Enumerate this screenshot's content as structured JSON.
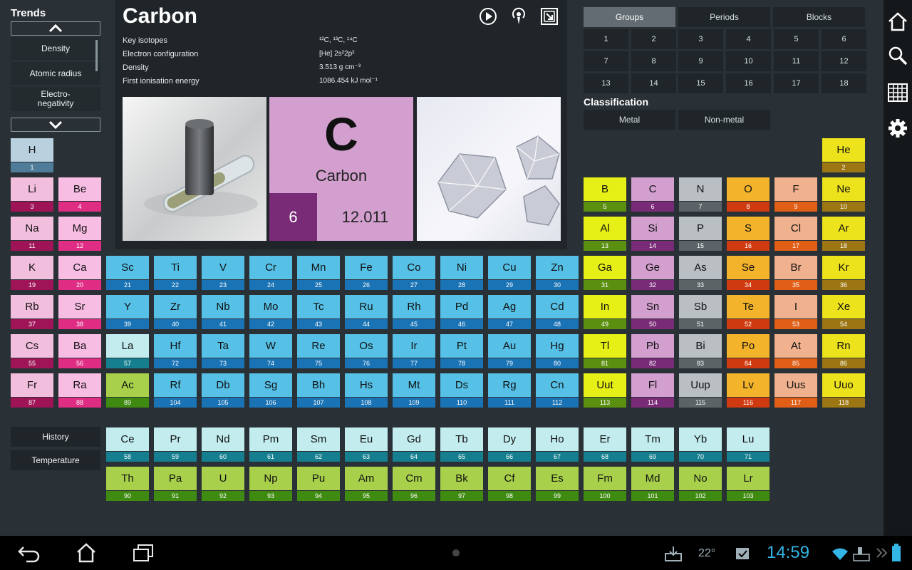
{
  "trends": {
    "title": "Trends",
    "items": [
      "Density",
      "Atomic radius",
      "Electro-\nnegativity"
    ],
    "bottom": [
      "History",
      "Temperature"
    ]
  },
  "element": {
    "name": "Carbon",
    "symbol": "C",
    "number": "6",
    "mass": "12.011",
    "props": [
      {
        "label": "Key isotopes",
        "value": "¹²C, ¹³C, ¹⁴C"
      },
      {
        "label": "Electron configuration",
        "value": "[He] 2s²2p²"
      },
      {
        "label": "Density",
        "value": "3.513 g cm⁻³"
      },
      {
        "label": "First ionisation energy",
        "value": "1086.454 kJ mol⁻¹"
      }
    ]
  },
  "tabs": [
    "Groups",
    "Periods",
    "Blocks"
  ],
  "active_tab": "Groups",
  "groups": [
    "1",
    "2",
    "3",
    "4",
    "5",
    "6",
    "7",
    "8",
    "9",
    "10",
    "11",
    "12",
    "13",
    "14",
    "15",
    "16",
    "17",
    "18"
  ],
  "classification": {
    "title": "Classification",
    "buttons": [
      "Metal",
      "Non-metal"
    ]
  },
  "status": {
    "temperature": "22°",
    "time": "14:59"
  },
  "categories": {
    "nonmetal": [
      "#b9d1de",
      "#4f7d99"
    ],
    "alkali": [
      "#f2bedd",
      "#9e1457"
    ],
    "alkaline": [
      "#f8bde3",
      "#e02d84"
    ],
    "transition": [
      "#56c0e6",
      "#1a73b5"
    ],
    "post_transition": [
      "#e6f016",
      "#5b8f10"
    ],
    "metalloid": [
      "#d39fcf",
      "#7a2b77"
    ],
    "carbon_group": [
      "#d39fcf",
      "#7a2b77"
    ],
    "pnictogen": [
      "#b9bfc2",
      "#5b6367"
    ],
    "chalcogen": [
      "#f3b32b",
      "#d03a10"
    ],
    "halogen": [
      "#f0b18e",
      "#e05e16"
    ],
    "noble": [
      "#ede31c",
      "#9c7612"
    ],
    "lanthanide": [
      "#c2ecee",
      "#157f8f"
    ],
    "actinide": [
      "#a8d04a",
      "#3f8a10"
    ]
  },
  "table_elements": [
    {
      "sym": "H",
      "num": "1",
      "cat": "nonmetal"
    },
    {
      "sym": "He",
      "num": "2",
      "cat": "noble"
    },
    {
      "sym": "Li",
      "num": "3",
      "cat": "alkali"
    },
    {
      "sym": "Be",
      "num": "4",
      "cat": "alkaline"
    },
    {
      "sym": "B",
      "num": "5",
      "cat": "post_transition"
    },
    {
      "sym": "C",
      "num": "6",
      "cat": "carbon_group"
    },
    {
      "sym": "N",
      "num": "7",
      "cat": "pnictogen"
    },
    {
      "sym": "O",
      "num": "8",
      "cat": "chalcogen"
    },
    {
      "sym": "F",
      "num": "9",
      "cat": "halogen"
    },
    {
      "sym": "Ne",
      "num": "10",
      "cat": "noble"
    },
    {
      "sym": "Na",
      "num": "11",
      "cat": "alkali"
    },
    {
      "sym": "Mg",
      "num": "12",
      "cat": "alkaline"
    },
    {
      "sym": "Al",
      "num": "13",
      "cat": "post_transition"
    },
    {
      "sym": "Si",
      "num": "14",
      "cat": "carbon_group"
    },
    {
      "sym": "P",
      "num": "15",
      "cat": "pnictogen"
    },
    {
      "sym": "S",
      "num": "16",
      "cat": "chalcogen"
    },
    {
      "sym": "Cl",
      "num": "17",
      "cat": "halogen"
    },
    {
      "sym": "Ar",
      "num": "18",
      "cat": "noble"
    },
    {
      "sym": "K",
      "num": "19",
      "cat": "alkali"
    },
    {
      "sym": "Ca",
      "num": "20",
      "cat": "alkaline"
    },
    {
      "sym": "Sc",
      "num": "21",
      "cat": "transition"
    },
    {
      "sym": "Ti",
      "num": "22",
      "cat": "transition"
    },
    {
      "sym": "V",
      "num": "23",
      "cat": "transition"
    },
    {
      "sym": "Cr",
      "num": "24",
      "cat": "transition"
    },
    {
      "sym": "Mn",
      "num": "25",
      "cat": "transition"
    },
    {
      "sym": "Fe",
      "num": "26",
      "cat": "transition"
    },
    {
      "sym": "Co",
      "num": "27",
      "cat": "transition"
    },
    {
      "sym": "Ni",
      "num": "28",
      "cat": "transition"
    },
    {
      "sym": "Cu",
      "num": "29",
      "cat": "transition"
    },
    {
      "sym": "Zn",
      "num": "30",
      "cat": "transition"
    },
    {
      "sym": "Ga",
      "num": "31",
      "cat": "post_transition"
    },
    {
      "sym": "Ge",
      "num": "32",
      "cat": "carbon_group"
    },
    {
      "sym": "As",
      "num": "33",
      "cat": "pnictogen"
    },
    {
      "sym": "Se",
      "num": "34",
      "cat": "chalcogen"
    },
    {
      "sym": "Br",
      "num": "35",
      "cat": "halogen"
    },
    {
      "sym": "Kr",
      "num": "36",
      "cat": "noble"
    },
    {
      "sym": "Rb",
      "num": "37",
      "cat": "alkali"
    },
    {
      "sym": "Sr",
      "num": "38",
      "cat": "alkaline"
    },
    {
      "sym": "Y",
      "num": "39",
      "cat": "transition"
    },
    {
      "sym": "Zr",
      "num": "40",
      "cat": "transition"
    },
    {
      "sym": "Nb",
      "num": "41",
      "cat": "transition"
    },
    {
      "sym": "Mo",
      "num": "42",
      "cat": "transition"
    },
    {
      "sym": "Tc",
      "num": "43",
      "cat": "transition"
    },
    {
      "sym": "Ru",
      "num": "44",
      "cat": "transition"
    },
    {
      "sym": "Rh",
      "num": "45",
      "cat": "transition"
    },
    {
      "sym": "Pd",
      "num": "46",
      "cat": "transition"
    },
    {
      "sym": "Ag",
      "num": "47",
      "cat": "transition"
    },
    {
      "sym": "Cd",
      "num": "48",
      "cat": "transition"
    },
    {
      "sym": "In",
      "num": "49",
      "cat": "post_transition"
    },
    {
      "sym": "Sn",
      "num": "50",
      "cat": "carbon_group"
    },
    {
      "sym": "Sb",
      "num": "51",
      "cat": "pnictogen"
    },
    {
      "sym": "Te",
      "num": "52",
      "cat": "chalcogen"
    },
    {
      "sym": "I",
      "num": "53",
      "cat": "halogen"
    },
    {
      "sym": "Xe",
      "num": "54",
      "cat": "noble"
    },
    {
      "sym": "Cs",
      "num": "55",
      "cat": "alkali"
    },
    {
      "sym": "Ba",
      "num": "56",
      "cat": "alkaline"
    },
    {
      "sym": "La",
      "num": "57",
      "cat": "lanthanide"
    },
    {
      "sym": "Hf",
      "num": "72",
      "cat": "transition"
    },
    {
      "sym": "Ta",
      "num": "73",
      "cat": "transition"
    },
    {
      "sym": "W",
      "num": "74",
      "cat": "transition"
    },
    {
      "sym": "Re",
      "num": "75",
      "cat": "transition"
    },
    {
      "sym": "Os",
      "num": "76",
      "cat": "transition"
    },
    {
      "sym": "Ir",
      "num": "77",
      "cat": "transition"
    },
    {
      "sym": "Pt",
      "num": "78",
      "cat": "transition"
    },
    {
      "sym": "Au",
      "num": "79",
      "cat": "transition"
    },
    {
      "sym": "Hg",
      "num": "80",
      "cat": "transition"
    },
    {
      "sym": "Tl",
      "num": "81",
      "cat": "post_transition"
    },
    {
      "sym": "Pb",
      "num": "82",
      "cat": "carbon_group"
    },
    {
      "sym": "Bi",
      "num": "83",
      "cat": "pnictogen"
    },
    {
      "sym": "Po",
      "num": "84",
      "cat": "chalcogen"
    },
    {
      "sym": "At",
      "num": "85",
      "cat": "halogen"
    },
    {
      "sym": "Rn",
      "num": "86",
      "cat": "noble"
    },
    {
      "sym": "Fr",
      "num": "87",
      "cat": "alkali"
    },
    {
      "sym": "Ra",
      "num": "88",
      "cat": "alkaline"
    },
    {
      "sym": "Ac",
      "num": "89",
      "cat": "actinide"
    },
    {
      "sym": "Rf",
      "num": "104",
      "cat": "transition"
    },
    {
      "sym": "Db",
      "num": "105",
      "cat": "transition"
    },
    {
      "sym": "Sg",
      "num": "106",
      "cat": "transition"
    },
    {
      "sym": "Bh",
      "num": "107",
      "cat": "transition"
    },
    {
      "sym": "Hs",
      "num": "108",
      "cat": "transition"
    },
    {
      "sym": "Mt",
      "num": "109",
      "cat": "transition"
    },
    {
      "sym": "Ds",
      "num": "110",
      "cat": "transition"
    },
    {
      "sym": "Rg",
      "num": "111",
      "cat": "transition"
    },
    {
      "sym": "Cn",
      "num": "112",
      "cat": "transition"
    },
    {
      "sym": "Uut",
      "num": "113",
      "cat": "post_transition"
    },
    {
      "sym": "Fl",
      "num": "114",
      "cat": "carbon_group"
    },
    {
      "sym": "Uup",
      "num": "115",
      "cat": "pnictogen"
    },
    {
      "sym": "Lv",
      "num": "116",
      "cat": "chalcogen"
    },
    {
      "sym": "Uus",
      "num": "117",
      "cat": "halogen"
    },
    {
      "sym": "Uuo",
      "num": "118",
      "cat": "noble"
    },
    {
      "sym": "Ce",
      "num": "58",
      "cat": "lanthanide"
    },
    {
      "sym": "Pr",
      "num": "59",
      "cat": "lanthanide"
    },
    {
      "sym": "Nd",
      "num": "60",
      "cat": "lanthanide"
    },
    {
      "sym": "Pm",
      "num": "61",
      "cat": "lanthanide"
    },
    {
      "sym": "Sm",
      "num": "62",
      "cat": "lanthanide"
    },
    {
      "sym": "Eu",
      "num": "63",
      "cat": "lanthanide"
    },
    {
      "sym": "Gd",
      "num": "64",
      "cat": "lanthanide"
    },
    {
      "sym": "Tb",
      "num": "65",
      "cat": "lanthanide"
    },
    {
      "sym": "Dy",
      "num": "66",
      "cat": "lanthanide"
    },
    {
      "sym": "Ho",
      "num": "67",
      "cat": "lanthanide"
    },
    {
      "sym": "Er",
      "num": "68",
      "cat": "lanthanide"
    },
    {
      "sym": "Tm",
      "num": "69",
      "cat": "lanthanide"
    },
    {
      "sym": "Yb",
      "num": "70",
      "cat": "lanthanide"
    },
    {
      "sym": "Lu",
      "num": "71",
      "cat": "lanthanide"
    },
    {
      "sym": "Th",
      "num": "90",
      "cat": "actinide"
    },
    {
      "sym": "Pa",
      "num": "91",
      "cat": "actinide"
    },
    {
      "sym": "U",
      "num": "92",
      "cat": "actinide"
    },
    {
      "sym": "Np",
      "num": "93",
      "cat": "actinide"
    },
    {
      "sym": "Pu",
      "num": "94",
      "cat": "actinide"
    },
    {
      "sym": "Am",
      "num": "95",
      "cat": "actinide"
    },
    {
      "sym": "Cm",
      "num": "96",
      "cat": "actinide"
    },
    {
      "sym": "Bk",
      "num": "97",
      "cat": "actinide"
    },
    {
      "sym": "Cf",
      "num": "98",
      "cat": "actinide"
    },
    {
      "sym": "Es",
      "num": "99",
      "cat": "actinide"
    },
    {
      "sym": "Fm",
      "num": "100",
      "cat": "actinide"
    },
    {
      "sym": "Md",
      "num": "101",
      "cat": "actinide"
    },
    {
      "sym": "No",
      "num": "102",
      "cat": "actinide"
    },
    {
      "sym": "Lr",
      "num": "103",
      "cat": "actinide"
    }
  ]
}
